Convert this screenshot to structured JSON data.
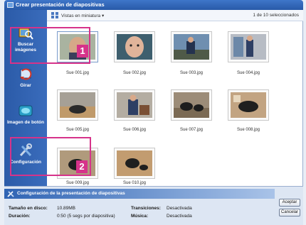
{
  "window": {
    "title": "Crear presentación de diapositivas"
  },
  "sidebar": {
    "items": [
      {
        "label": "Buscar imágenes"
      },
      {
        "label": "Girar"
      },
      {
        "label": "Imagen de botón"
      },
      {
        "label": "Configuración"
      }
    ]
  },
  "toolbar": {
    "view_label": "Vistas en miniatura ▾",
    "selection_count": "1 de 10 seleccionados"
  },
  "thumbnails": [
    {
      "caption": "Sue 001.jpg"
    },
    {
      "caption": "Sue 002.jpg"
    },
    {
      "caption": "Sue 003.jpg"
    },
    {
      "caption": "Sue 004.jpg"
    },
    {
      "caption": "Sue 005.jpg"
    },
    {
      "caption": "Sue 006.jpg"
    },
    {
      "caption": "Sue 007.jpg"
    },
    {
      "caption": "Sue 008.jpg"
    },
    {
      "caption": "Sue 009.jpg"
    },
    {
      "caption": "Sue 010.jpg"
    }
  ],
  "footer": {
    "title": "Configuración de la presentación de diapositivas",
    "size_label": "Tamaño en disco:",
    "size_value": "10.89MB",
    "duration_label": "Duración:",
    "duration_value": "0:50 (5 segs por diapositiva)",
    "transitions_label": "Transiciones:",
    "transitions_value": "Desactivada",
    "music_label": "Música:",
    "music_value": "Desactivada",
    "accept_label": "Aceptar",
    "cancel_label": "Cancelar"
  },
  "callouts": {
    "badge1": "1",
    "badge2": "2"
  },
  "colors": {
    "accent": "#d6338a",
    "sidebar": "#2b5ba8",
    "titlebar": "#285aa8"
  }
}
